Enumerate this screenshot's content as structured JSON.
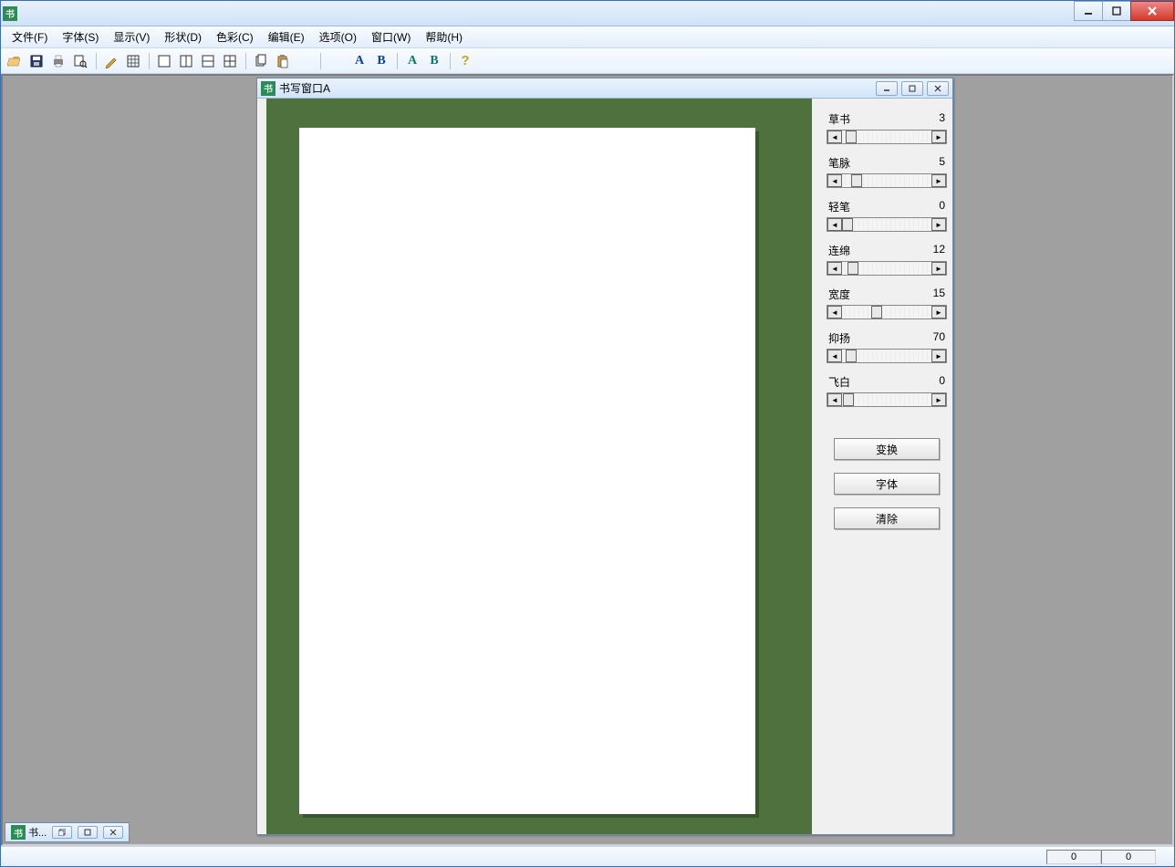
{
  "menus": [
    "文件(F)",
    "字体(S)",
    "显示(V)",
    "形状(D)",
    "色彩(C)",
    "编辑(E)",
    "选项(O)",
    "窗口(W)",
    "帮助(H)"
  ],
  "child_window": {
    "title": "书写窗口A"
  },
  "sliders": [
    {
      "label": "草书",
      "value": "3",
      "thumb": 20
    },
    {
      "label": "笔脉",
      "value": "5",
      "thumb": 26
    },
    {
      "label": "轻笔",
      "value": "0",
      "thumb": 16
    },
    {
      "label": "连绵",
      "value": "12",
      "thumb": 22
    },
    {
      "label": "宽度",
      "value": "15",
      "thumb": 48
    },
    {
      "label": "抑扬",
      "value": "70",
      "thumb": 20
    },
    {
      "label": "飞白",
      "value": "0",
      "thumb": 17
    }
  ],
  "buttons": {
    "transform": "变换",
    "font": "字体",
    "clear": "清除"
  },
  "mdi_tab": "书...",
  "status": {
    "x": "0",
    "y": "0"
  }
}
